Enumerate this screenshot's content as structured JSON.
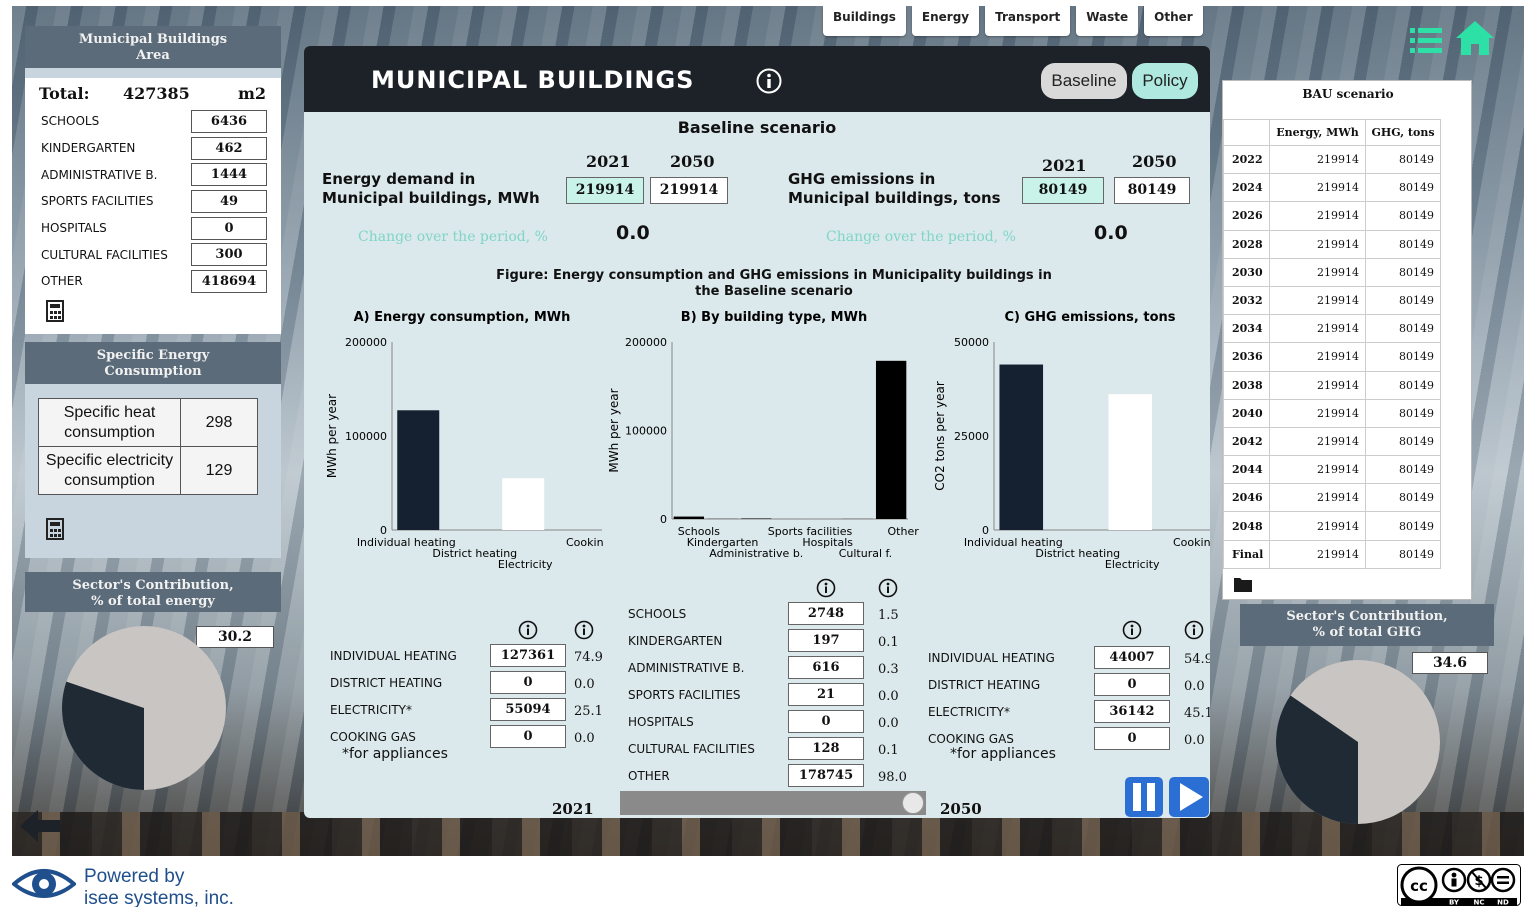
{
  "nav": {
    "tabs": [
      "Buildings",
      "Energy",
      "Transport",
      "Waste",
      "Other"
    ]
  },
  "left": {
    "area_title_1": "Municipal Buildings",
    "area_title_2": "Area",
    "total_label": "Total:",
    "total_value": "427385",
    "total_unit": "m2",
    "rows": [
      {
        "label": "SCHOOLS",
        "value": "6436"
      },
      {
        "label": "KINDERGARTEN",
        "value": "462"
      },
      {
        "label": "ADMINISTRATIVE B.",
        "value": "1444"
      },
      {
        "label": "SPORTS FACILITIES",
        "value": "49"
      },
      {
        "label": "HOSPITALS",
        "value": "0"
      },
      {
        "label": "CULTURAL FACILITIES",
        "value": "300"
      },
      {
        "label": "OTHER",
        "value": "418694"
      }
    ],
    "sec_title_1": "Specific Energy",
    "sec_title_2": "Consumption",
    "heat_label_1": "Specific heat",
    "heat_label_2": "consumption",
    "heat_value": "298",
    "elec_label_1": "Specific electricity",
    "elec_label_2": "consumption",
    "elec_value": "129",
    "contrib_title_1": "Sector's Contribution,",
    "contrib_title_2": "% of total energy",
    "contrib_value": "30.2",
    "contrib_fraction": 0.302
  },
  "main": {
    "title": "MUNICIPAL BUILDINGS",
    "baseline_btn": "Baseline",
    "policy_btn": "Policy",
    "scenario": "Baseline scenario",
    "year_start": "2021",
    "year_end": "2050",
    "energy_label_1": "Energy demand in",
    "energy_label_2": "Municipal buildings, MWh",
    "energy_2021": "219914",
    "energy_2050": "219914",
    "ghg_label_1": "GHG emissions in",
    "ghg_label_2": "Municipal buildings, tons",
    "ghg_2021": "80149",
    "ghg_2050": "80149",
    "change_label": "Change over the period, %",
    "change_energy": "0.0",
    "change_ghg": "0.0",
    "fig_caption_1": "Figure: Energy consumption and GHG emissions in Municipality buildings in",
    "fig_caption_2": "the Baseline scenario",
    "note_appliances": "*for appliances",
    "slider_start": "2021",
    "slider_end": "2050"
  },
  "energy_table": [
    {
      "label": "INDIVIDUAL HEATING",
      "value": "127361",
      "pct": "74.9"
    },
    {
      "label": "DISTRICT HEATING",
      "value": "0",
      "pct": "0.0"
    },
    {
      "label": "ELECTRICITY*",
      "value": "55094",
      "pct": "25.1"
    },
    {
      "label": "COOKING GAS",
      "value": "0",
      "pct": "0.0"
    }
  ],
  "type_table": [
    {
      "label": "SCHOOLS",
      "value": "2748",
      "pct": "1.5"
    },
    {
      "label": "KINDERGARTEN",
      "value": "197",
      "pct": "0.1"
    },
    {
      "label": "ADMINISTRATIVE B.",
      "value": "616",
      "pct": "0.3"
    },
    {
      "label": "SPORTS FACILITIES",
      "value": "21",
      "pct": "0.0"
    },
    {
      "label": "HOSPITALS",
      "value": "0",
      "pct": "0.0"
    },
    {
      "label": "CULTURAL FACILITIES",
      "value": "128",
      "pct": "0.1"
    },
    {
      "label": "OTHER",
      "value": "178745",
      "pct": "98.0"
    }
  ],
  "ghg_table": [
    {
      "label": "INDIVIDUAL HEATING",
      "value": "44007",
      "pct": "54.9"
    },
    {
      "label": "DISTRICT HEATING",
      "value": "0",
      "pct": "0.0"
    },
    {
      "label": "ELECTRICITY*",
      "value": "36142",
      "pct": "45.1"
    },
    {
      "label": "COOKING GAS",
      "value": "0",
      "pct": "0.0"
    }
  ],
  "chart_data": [
    {
      "type": "bar",
      "title": "A) Energy consumption, MWh",
      "ylabel": "MWh per year",
      "categories": [
        "Individual heating",
        "District heating",
        "Electricity",
        "Cooking gas"
      ],
      "values": [
        127361,
        0,
        55094,
        0
      ],
      "colors": [
        "#152030",
        "#152030",
        "#ffffff",
        "#152030"
      ],
      "yticks": [
        "0",
        "100000",
        "200000"
      ],
      "ylim": [
        0,
        200000
      ]
    },
    {
      "type": "bar",
      "title": "B) By building type, MWh",
      "ylabel": "MWh per year",
      "categories": [
        "Schools",
        "Kindergarten",
        "Administrative b.",
        "Sports facilities",
        "Hospitals",
        "Cultural f.",
        "Other"
      ],
      "values": [
        2748,
        197,
        616,
        21,
        0,
        128,
        178745
      ],
      "colors": [
        "#000000",
        "#000000",
        "#000000",
        "#000000",
        "#000000",
        "#000000",
        "#000000"
      ],
      "yticks": [
        "0",
        "100000",
        "200000"
      ],
      "ylim": [
        0,
        200000
      ]
    },
    {
      "type": "bar",
      "title": "C) GHG emissions, tons",
      "ylabel": "CO2 tons per year",
      "categories": [
        "Individual heating",
        "District heating",
        "Electricity",
        "Cooking gas"
      ],
      "values": [
        44007,
        0,
        36142,
        0
      ],
      "colors": [
        "#152030",
        "#152030",
        "#ffffff",
        "#152030"
      ],
      "yticks": [
        "0",
        "25000",
        "50000"
      ],
      "ylim": [
        0,
        50000
      ]
    }
  ],
  "bau": {
    "title": "BAU scenario",
    "col_energy": "Energy, MWh",
    "col_ghg": "GHG, tons",
    "rows": [
      {
        "year": "2022",
        "energy": "219914",
        "ghg": "80149"
      },
      {
        "year": "2024",
        "energy": "219914",
        "ghg": "80149"
      },
      {
        "year": "2026",
        "energy": "219914",
        "ghg": "80149"
      },
      {
        "year": "2028",
        "energy": "219914",
        "ghg": "80149"
      },
      {
        "year": "2030",
        "energy": "219914",
        "ghg": "80149"
      },
      {
        "year": "2032",
        "energy": "219914",
        "ghg": "80149"
      },
      {
        "year": "2034",
        "energy": "219914",
        "ghg": "80149"
      },
      {
        "year": "2036",
        "energy": "219914",
        "ghg": "80149"
      },
      {
        "year": "2038",
        "energy": "219914",
        "ghg": "80149"
      },
      {
        "year": "2040",
        "energy": "219914",
        "ghg": "80149"
      },
      {
        "year": "2042",
        "energy": "219914",
        "ghg": "80149"
      },
      {
        "year": "2044",
        "energy": "219914",
        "ghg": "80149"
      },
      {
        "year": "2046",
        "energy": "219914",
        "ghg": "80149"
      },
      {
        "year": "2048",
        "energy": "219914",
        "ghg": "80149"
      },
      {
        "year": "Final",
        "energy": "219914",
        "ghg": "80149"
      }
    ]
  },
  "right": {
    "contrib_title_1": "Sector's Contribution,",
    "contrib_title_2": "% of total GHG",
    "contrib_value": "34.6",
    "contrib_fraction": 0.346
  },
  "footer": {
    "powered_1": "Powered by",
    "powered_2": "isee systems, inc.",
    "cc_by": "BY",
    "cc_nc": "NC",
    "cc_nd": "ND"
  },
  "colors": {
    "panel_header": "#5b6b79",
    "title_bar": "#1d2228",
    "accent_green": "#aee8df",
    "change_text": "#7fd6c7",
    "pie_dark": "#1f2a35",
    "pie_light": "#c9c5c2",
    "play_blue": "#2b6fd4"
  }
}
